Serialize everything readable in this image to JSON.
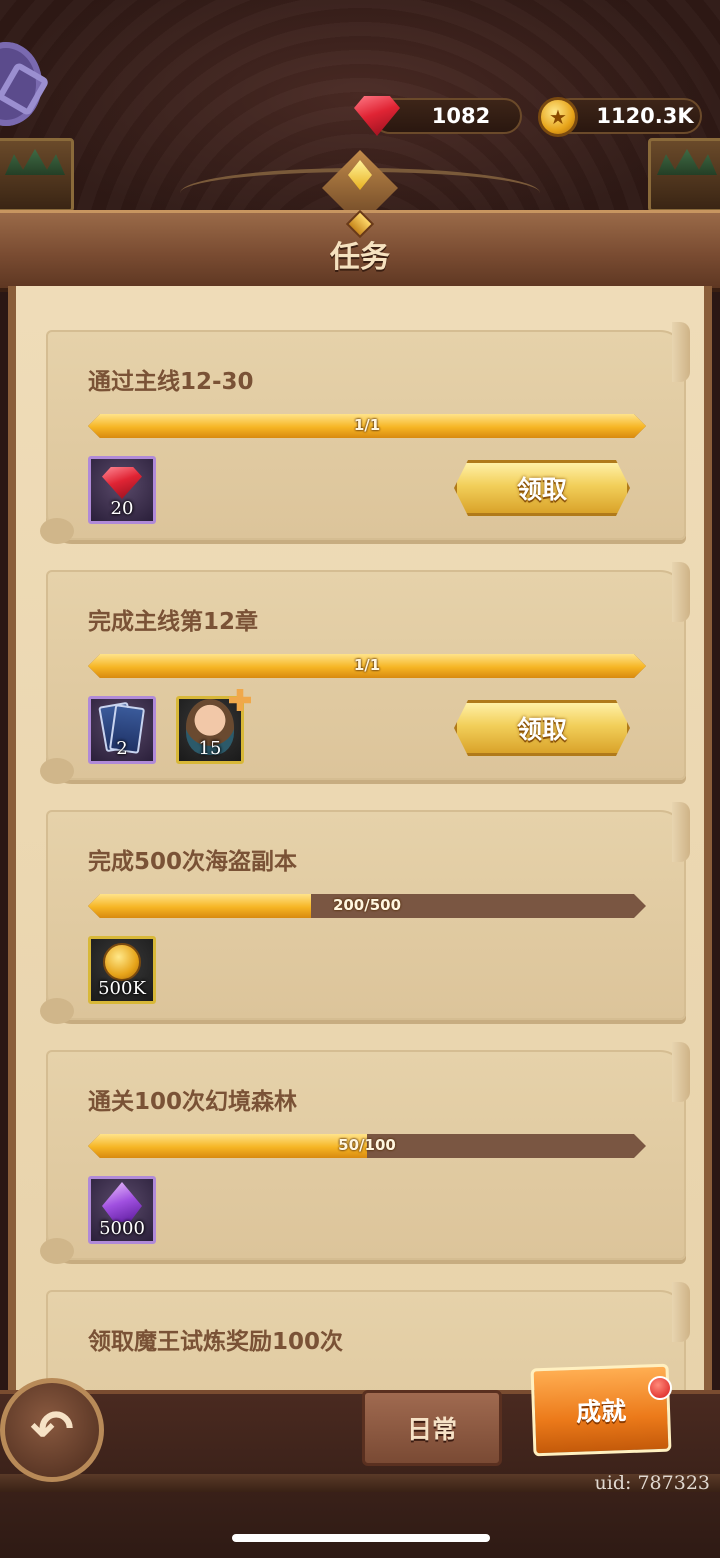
{
  "currency": {
    "gems": "1082",
    "gold": "1120.3K"
  },
  "header": {
    "title": "任务"
  },
  "tasks": [
    {
      "title": "通过主线12-30",
      "progress_text": "1/1",
      "progress_fraction": 1.0,
      "rewards": [
        {
          "icon": "ruby-gem-icon",
          "count": "20"
        }
      ],
      "claim_label": "领取"
    },
    {
      "title": "完成主线第12章",
      "progress_text": "1/1",
      "progress_fraction": 1.0,
      "rewards": [
        {
          "icon": "card-pack-icon",
          "count": "2"
        },
        {
          "icon": "hero-fragment-icon",
          "count": "15"
        }
      ],
      "claim_label": "领取"
    },
    {
      "title": "完成500次海盗副本",
      "progress_text": "200/500",
      "progress_fraction": 0.4,
      "rewards": [
        {
          "icon": "gold-coin-icon",
          "count": "500K"
        }
      ]
    },
    {
      "title": "通关100次幻境森林",
      "progress_text": "50/100",
      "progress_fraction": 0.5,
      "rewards": [
        {
          "icon": "purple-crystal-icon",
          "count": "5000"
        }
      ]
    },
    {
      "title": "领取魔王试炼奖励100次"
    }
  ],
  "tabs": {
    "daily": "日常",
    "achievement": "成就"
  },
  "uid": "uid: 787323"
}
